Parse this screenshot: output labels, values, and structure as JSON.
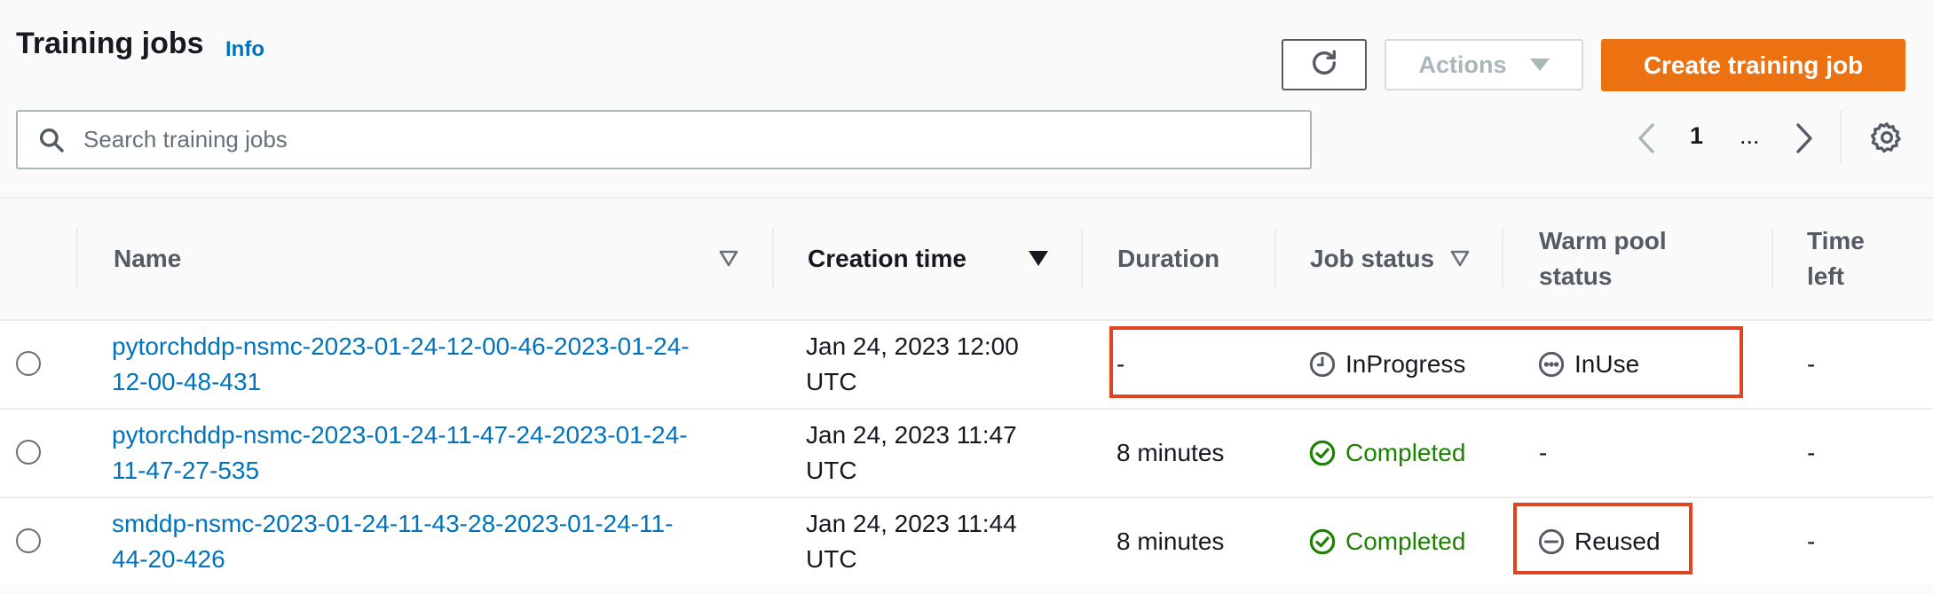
{
  "header": {
    "title": "Training jobs",
    "info_label": "Info"
  },
  "toolbar": {
    "refresh_icon": "refresh-icon",
    "actions_label": "Actions",
    "create_label": "Create training job"
  },
  "search": {
    "placeholder": "Search training jobs"
  },
  "pagination": {
    "current_page": "1",
    "ellipsis": "..."
  },
  "table": {
    "columns": {
      "name": "Name",
      "creation_time": "Creation time",
      "duration": "Duration",
      "job_status": "Job status",
      "warm_pool_line1": "Warm pool",
      "warm_pool_line2": "status",
      "time_left_line1": "Time",
      "time_left_line2": "left"
    },
    "rows": [
      {
        "name_line1": "pytorchddp-nsmc-2023-01-24-12-00-46-2023-01-24-",
        "name_line2": "12-00-48-431",
        "created_line1": "Jan 24, 2023 12:00",
        "created_line2": "UTC",
        "duration": "-",
        "job_status": "InProgress",
        "job_status_icon": "clock-icon",
        "warm_pool": "InUse",
        "warm_pool_icon": "ellipsis-circle-icon",
        "time_left": "-"
      },
      {
        "name_line1": "pytorchddp-nsmc-2023-01-24-11-47-24-2023-01-24-",
        "name_line2": "11-47-27-535",
        "created_line1": "Jan 24, 2023 11:47",
        "created_line2": "UTC",
        "duration": "8 minutes",
        "job_status": "Completed",
        "job_status_icon": "check-circle-icon",
        "warm_pool": "-",
        "time_left": "-"
      },
      {
        "name_line1": "smddp-nsmc-2023-01-24-11-43-28-2023-01-24-11-",
        "name_line2": "44-20-426",
        "created_line1": "Jan 24, 2023 11:44",
        "created_line2": "UTC",
        "duration": "8 minutes",
        "job_status": "Completed",
        "job_status_icon": "check-circle-icon",
        "warm_pool": "Reused",
        "warm_pool_icon": "minus-circle-icon",
        "time_left": "-"
      }
    ]
  },
  "colors": {
    "primary_button": "#ec7211",
    "link": "#0073bb",
    "success": "#1d8102",
    "highlight_box": "#e0451f"
  }
}
